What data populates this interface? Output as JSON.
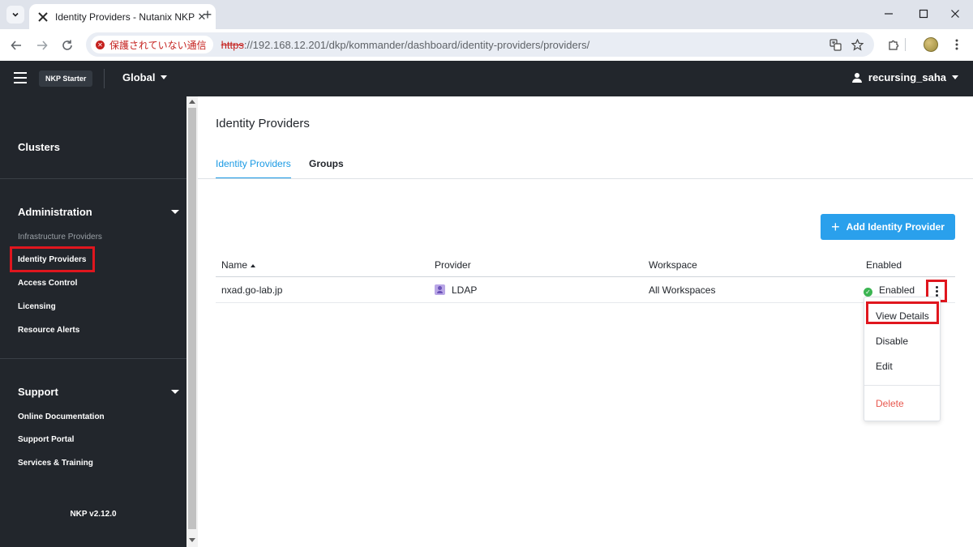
{
  "browser": {
    "tab_title": "Identity Providers - Nutanix NKP",
    "close_glyph": "✕",
    "new_tab_glyph": "+",
    "security_label": "保護されていない通信",
    "security_icon_glyph": "✕",
    "url_scheme": "https",
    "url_rest": "://192.168.12.201/dkp/kommander/dashboard/identity-providers/providers/"
  },
  "topbar": {
    "brand": "NKP Starter",
    "context": "Global",
    "user": "recursing_saha"
  },
  "sidebar": {
    "clusters": "Clusters",
    "administration": {
      "title": "Administration",
      "items": [
        "Infrastructure Providers",
        "Identity Providers",
        "Access Control",
        "Licensing",
        "Resource Alerts"
      ]
    },
    "support": {
      "title": "Support",
      "items": [
        "Online Documentation",
        "Support Portal",
        "Services & Training"
      ]
    },
    "version": "NKP v2.12.0"
  },
  "main": {
    "title": "Identity Providers",
    "tabs": [
      "Identity Providers",
      "Groups"
    ],
    "add_button": "Add Identity Provider",
    "add_glyph": "+",
    "table": {
      "columns": [
        "Name",
        "Provider",
        "Workspace",
        "Enabled"
      ],
      "rows": [
        {
          "name": "nxad.go-lab.jp",
          "provider": "LDAP",
          "workspace": "All Workspaces",
          "enabled": "Enabled",
          "enabled_glyph": "✓"
        }
      ]
    },
    "row_menu": {
      "items": [
        "View Details",
        "Disable",
        "Edit"
      ],
      "danger_item": "Delete"
    }
  },
  "colors": {
    "accent": "#1b9ae4",
    "primary_button": "#2aa0ec",
    "sidebar_bg": "#22262c",
    "highlight": "#e0161e",
    "status_ok": "#3cb552",
    "danger": "#e8584f"
  }
}
